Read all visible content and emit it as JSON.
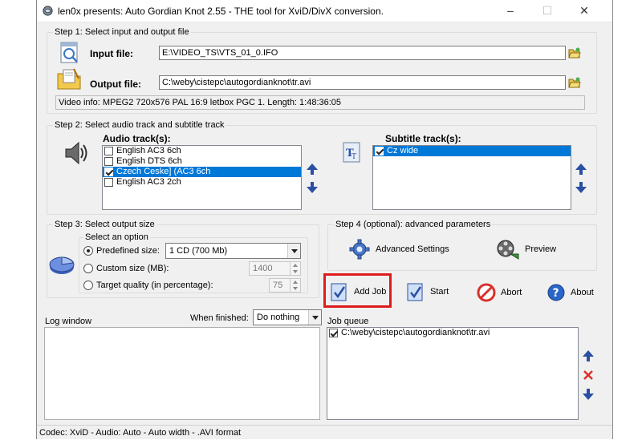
{
  "window": {
    "title": "len0x presents: Auto Gordian Knot 2.55 - THE tool for XviD/DivX conversion.",
    "controls": {
      "minimize": "–",
      "maximize": "☐",
      "close": "✕"
    }
  },
  "step1": {
    "title": "Step 1: Select input and output file",
    "input_label": "Input file:",
    "input_value": "E:\\VIDEO_TS\\VTS_01_0.IFO",
    "output_label": "Output file:",
    "output_value": "C:\\weby\\cistepc\\autogordianknot\\tr.avi",
    "video_info": "Video info: MPEG2 720x576 PAL 16:9 letbox  PGC 1. Length: 1:48:36:05"
  },
  "step2": {
    "title": "Step 2: Select audio track and subtitle track",
    "audio_label": "Audio track(s):",
    "audio_tracks": [
      {
        "label": "English AC3 6ch",
        "checked": false,
        "selected": false
      },
      {
        "label": "English DTS 6ch",
        "checked": false,
        "selected": false
      },
      {
        "label": "Czech Ceske] (AC3 6ch",
        "checked": true,
        "selected": true
      },
      {
        "label": "English AC3 2ch",
        "checked": false,
        "selected": false
      }
    ],
    "subtitle_label": "Subtitle track(s):",
    "subtitle_tracks": [
      {
        "label": "Cz wide",
        "checked": true,
        "selected": true
      }
    ]
  },
  "step3": {
    "title": "Step 3: Select output size",
    "option_title": "Select an option",
    "predefined_label": "Predefined size:",
    "predefined_value": "1 CD (700 Mb)",
    "custom_label": "Custom size (MB):",
    "custom_value": "1400",
    "quality_label": "Target quality (in percentage):",
    "quality_value": "75",
    "selected_option": "predefined"
  },
  "step4": {
    "title": "Step 4 (optional): advanced parameters",
    "advanced_label": "Advanced Settings",
    "preview_label": "Preview"
  },
  "actions": {
    "add_job": "Add Job",
    "start": "Start",
    "abort": "Abort",
    "about": "About"
  },
  "log": {
    "title": "Log window",
    "when_finished_label": "When finished:",
    "when_finished_value": "Do nothing"
  },
  "queue": {
    "title": "Job queue",
    "items": [
      {
        "label": "C:\\weby\\cistepc\\autogordianknot\\tr.avi",
        "checked": true
      }
    ]
  },
  "status_bar": "Codec: XviD -  Audio: Auto -  Auto width - .AVI format",
  "colors": {
    "highlight": "#0078d7",
    "annotation_box": "#e01b1b"
  }
}
